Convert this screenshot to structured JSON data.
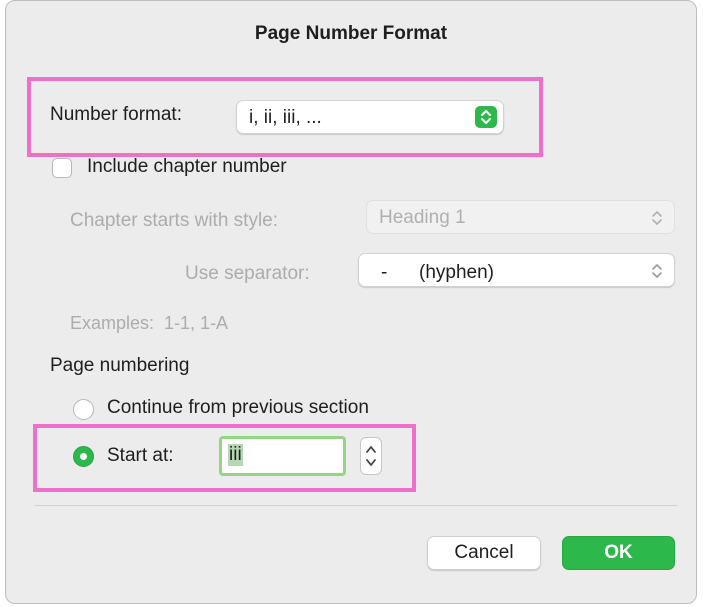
{
  "dialog": {
    "title": "Page Number Format"
  },
  "number_format": {
    "label": "Number format:",
    "value": "i, ii, iii, ..."
  },
  "include_chapter": {
    "label": "Include chapter number",
    "checked": false
  },
  "chapter_style": {
    "label": "Chapter starts with style:",
    "value": "Heading 1"
  },
  "separator": {
    "label": "Use separator:",
    "value": "-      (hyphen)"
  },
  "examples": {
    "text": "Examples:  1-1, 1-A"
  },
  "page_numbering": {
    "heading": "Page numbering",
    "continue_label": "Continue from previous section",
    "start_label": "Start at:",
    "start_value": "iii",
    "selected": "start_at"
  },
  "buttons": {
    "cancel": "Cancel",
    "ok": "OK"
  },
  "colors": {
    "accent": "#2db84c",
    "highlight": "#f06fc8"
  }
}
